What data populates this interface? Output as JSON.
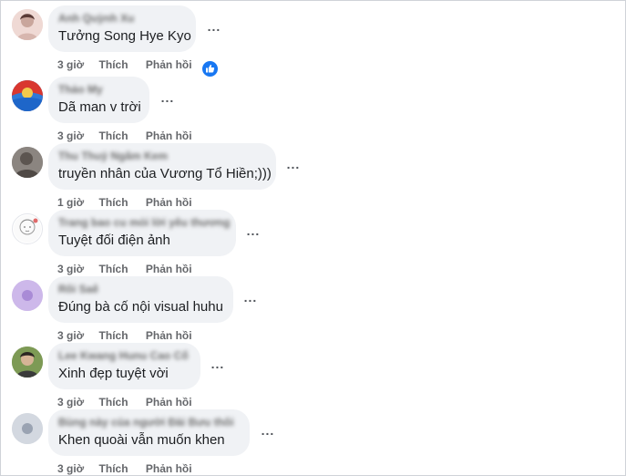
{
  "comments": [
    {
      "author": "Anh Quỳnh Xu",
      "text": "Tưởng Song Hye Kyo",
      "time": "3 giờ",
      "like": "Thích",
      "reply": "Phản hồi",
      "more": "...",
      "avatar": "avatar-photo",
      "reaction": "like-icon"
    },
    {
      "author": "Thảo My",
      "text": "Dã man v trời",
      "time": "3 giờ",
      "like": "Thích",
      "reply": "Phản hồi",
      "more": "...",
      "avatar": "avatar-photo"
    },
    {
      "author": "Thu Thuỷ Ngâm Kem",
      "text": "truyền nhân của Vương Tổ Hiền;)))",
      "time": "1 giờ",
      "like": "Thích",
      "reply": "Phản hồi",
      "more": "...",
      "avatar": "avatar-photo"
    },
    {
      "author": "Trang bao cu mỏi lời yêu thương",
      "text": "Tuyệt đối điện ảnh",
      "time": "3 giờ",
      "like": "Thích",
      "reply": "Phản hồi",
      "more": "...",
      "avatar": "avatar-photo"
    },
    {
      "author": "Rôi Saê",
      "text": "Đúng bà cố nội visual huhu",
      "time": "3 giờ",
      "like": "Thích",
      "reply": "Phản hồi",
      "more": "...",
      "avatar": "avatar-initial"
    },
    {
      "author": "Lee Kwang Hunu Cao Cố",
      "text": "Xinh đẹp tuyệt vời",
      "time": "3 giờ",
      "like": "Thích",
      "reply": "Phản hồi",
      "more": "...",
      "avatar": "avatar-photo"
    },
    {
      "author": "Bùng này của người Đài Bưu thôi",
      "text": "Khen quoài vẫn muốn khen",
      "time": "3 giờ",
      "like": "Thích",
      "reply": "Phản hồi",
      "more": "...",
      "avatar": "avatar-initial"
    }
  ],
  "colors": {
    "bubble": "#f0f2f5",
    "meta": "#65676b",
    "like_blue": "#1877f2"
  }
}
